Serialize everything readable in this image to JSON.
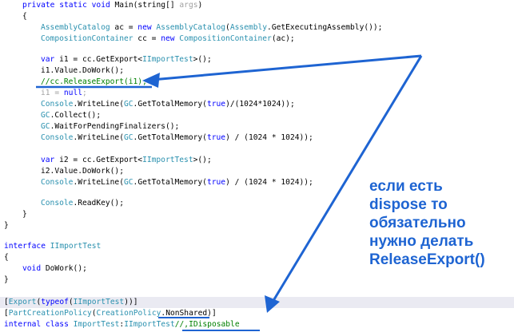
{
  "colors": {
    "keyword": "#0000ff",
    "type": "#2b91af",
    "comment": "#008000",
    "grayed": "#a0a0a0",
    "annotation": "#1e64d2"
  },
  "code": {
    "main_signature": {
      "kw1": "private static void",
      "name": "Main",
      "p1": "(string[] ",
      "args": "args",
      "p2": ")"
    },
    "open_brace": "{",
    "catalog": {
      "type1": "AssemblyCatalog",
      "mid": " ac = ",
      "kw": "new",
      "sp": " ",
      "type2": "AssemblyCatalog",
      "rest1": "(",
      "type3": "Assembly",
      "rest2": ".GetExecutingAssembly());"
    },
    "container": {
      "type1": "CompositionContainer",
      "mid": " cc = ",
      "kw": "new",
      "sp": " ",
      "type2": "CompositionContainer",
      "rest": "(ac);"
    },
    "i1_export": {
      "kw": "var",
      "mid": " i1 = cc.GetExport<",
      "type": "IImportTest",
      "rest": ">();"
    },
    "i1_dowork": "i1.Value.DoWork();",
    "release_comment": "//cc.ReleaseExport(i1);",
    "i1_null": {
      "a": "i1 = ",
      "kw": "null",
      "b": ";"
    },
    "mem1": {
      "type1": "Console",
      "a": ".WriteLine(",
      "type2": "GC",
      "b": ".GetTotalMemory(",
      "kw": "true",
      "c": ")/(1024*1024));"
    },
    "gc_collect": {
      "type": "GC",
      "rest": ".Collect();"
    },
    "gc_wait": {
      "type": "GC",
      "rest": ".WaitForPendingFinalizers();"
    },
    "mem2": {
      "type1": "Console",
      "a": ".WriteLine(",
      "type2": "GC",
      "b": ".GetTotalMemory(",
      "kw": "true",
      "c": ") / (1024 * 1024));"
    },
    "i2_export": {
      "kw": "var",
      "mid": " i2 = cc.GetExport<",
      "type": "IImportTest",
      "rest": ">();"
    },
    "i2_dowork": "i2.Value.DoWork();",
    "mem3": {
      "type1": "Console",
      "a": ".WriteLine(",
      "type2": "GC",
      "b": ".GetTotalMemory(",
      "kw": "true",
      "c": ") / (1024 * 1024));"
    },
    "readkey": {
      "type": "Console",
      "rest": ".ReadKey();"
    },
    "close_inner": "}",
    "close_outer": "}",
    "iface_decl": {
      "kw": "interface",
      "sp": " ",
      "type": "IImportTest"
    },
    "iface_open": "{",
    "iface_method": {
      "kw": "void",
      "rest": " DoWork();"
    },
    "iface_close": "}",
    "attr_export": {
      "a": "[",
      "type": "Export",
      "b": "(",
      "kw": "typeof",
      "c": "(",
      "type2": "IImportTest",
      "d": "))]"
    },
    "attr_policy": {
      "a": "[",
      "type": "PartCreationPolicy",
      "b": "(",
      "type2": "CreationPolicy",
      "c": ".",
      "ns": "NonShared",
      "d": ")]"
    },
    "class_decl": {
      "kw": "internal class",
      "sp": " ",
      "type": "ImportTest",
      "colon": ":",
      "type2": "IImportTest",
      "cm": "//,IDisposable"
    }
  },
  "annotation": {
    "lines": [
      "если есть",
      "dispose то",
      "обязательно",
      "нужно делать",
      "ReleaseExport()"
    ]
  }
}
